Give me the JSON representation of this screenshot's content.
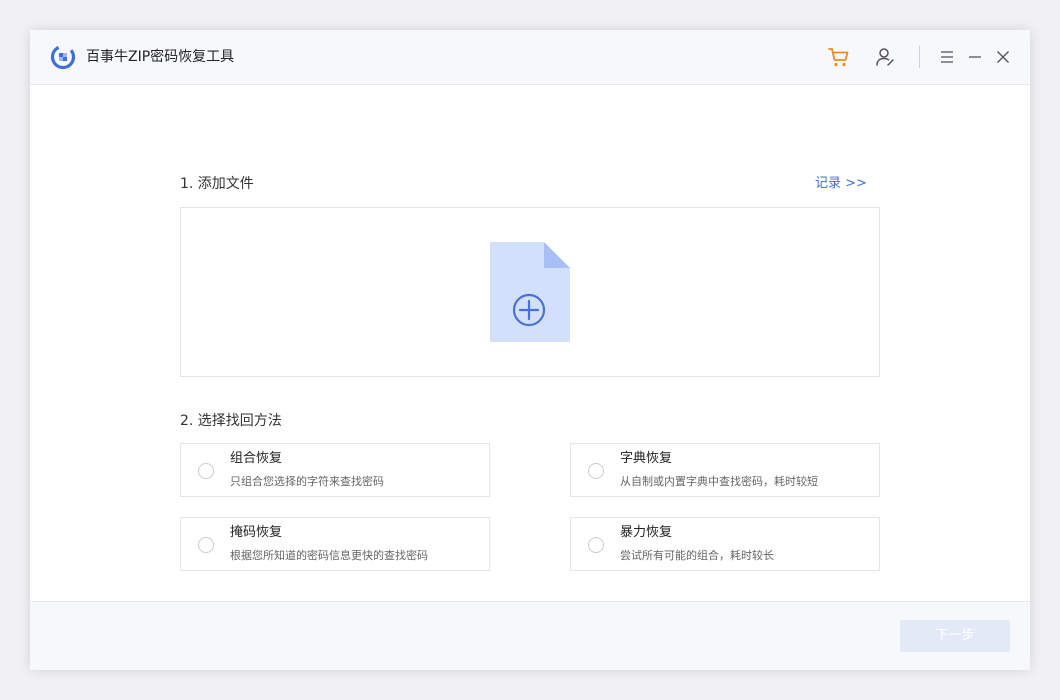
{
  "window": {
    "title": "百事牛ZIP密码恢复工具"
  },
  "titlebar": {
    "icons": [
      "cart-icon",
      "user-icon",
      "menu-icon",
      "minimize-icon",
      "close-icon"
    ]
  },
  "colors": {
    "accent": "#3d6fd8",
    "cart": "#f08a24",
    "file_icon_fill": "#d3e0fb",
    "file_icon_fold": "#a8c0f5",
    "plus_stroke": "#4a72d6",
    "next_button_bg": "#e4e9f8"
  },
  "add_file": {
    "heading": "1. 添加文件",
    "record_link": "记录 >>"
  },
  "method": {
    "heading": "2. 选择找回方法",
    "options": [
      {
        "title": "组合恢复",
        "desc": "只组合您选择的字符来查找密码"
      },
      {
        "title": "字典恢复",
        "desc": "从自制或内置字典中查找密码，耗时较短"
      },
      {
        "title": "掩码恢复",
        "desc": "根据您所知道的密码信息更快的查找密码"
      },
      {
        "title": "暴力恢复",
        "desc": "尝试所有可能的组合，耗时较长"
      }
    ]
  },
  "footer": {
    "next_label": "下一步"
  }
}
